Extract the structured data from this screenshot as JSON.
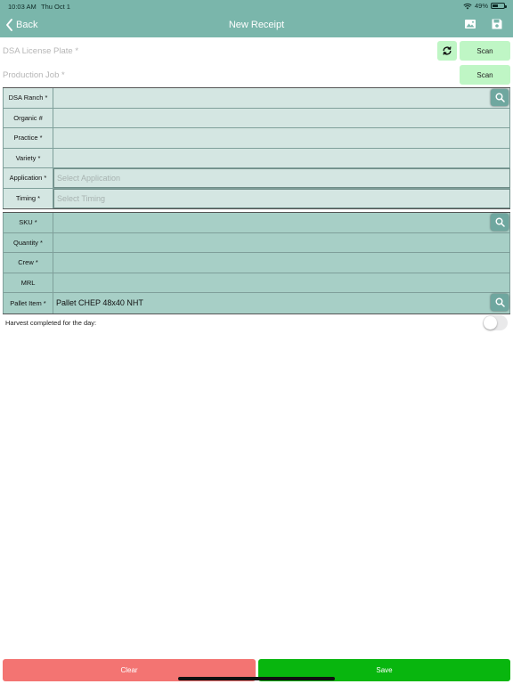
{
  "status_bar": {
    "time": "10:03 AM",
    "date": "Thu Oct 1",
    "battery": "49%"
  },
  "nav": {
    "back_label": "Back",
    "title": "New Receipt",
    "icons": [
      "image-icon",
      "save-icon"
    ]
  },
  "license_plate": {
    "placeholder": "DSA License Plate *",
    "scan_label": "Scan"
  },
  "production_job": {
    "placeholder": "Production Job *",
    "scan_label": "Scan"
  },
  "section1": [
    {
      "label": "DSA Ranch *",
      "value": "",
      "has_search": true
    },
    {
      "label": "Organic #",
      "value": ""
    },
    {
      "label": "Practice *",
      "value": ""
    },
    {
      "label": "Variety *",
      "value": ""
    },
    {
      "label": "Application *",
      "placeholder": "Select Application"
    },
    {
      "label": "Timing *",
      "placeholder": "Select Timing"
    }
  ],
  "section2": [
    {
      "label": "SKU *",
      "value": "",
      "has_search": true
    },
    {
      "label": "Quantity *",
      "value": ""
    },
    {
      "label": "Crew *",
      "value": ""
    },
    {
      "label": "MRL",
      "value": ""
    },
    {
      "label": "Pallet Item *",
      "value": "Pallet CHEP 48x40 NHT",
      "has_search": true
    }
  ],
  "harvest": {
    "label": "Harvest completed for the day:",
    "toggle_on": false
  },
  "actions": {
    "clear_label": "Clear",
    "save_label": "Save"
  },
  "colors": {
    "header": "#7ab6ab",
    "scan_button": "#bff6c5",
    "section1_bg": "#d4e6e2",
    "section2_bg": "#a7cfc6",
    "clear_button": "#f37472",
    "save_button": "#08b60e"
  }
}
